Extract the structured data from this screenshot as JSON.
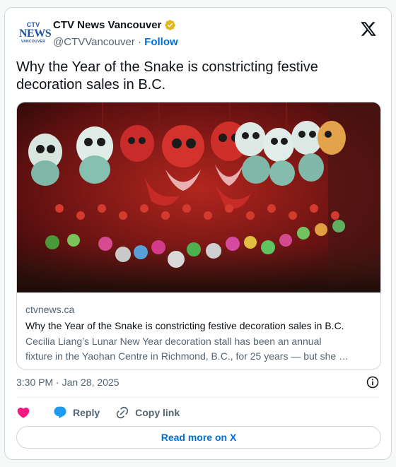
{
  "author": {
    "logo_lines": [
      "CTV",
      "NEWS",
      "VANCOUVER"
    ],
    "name": "CTV News Vancouver",
    "handle": "@CTVVancouver",
    "separator": "·",
    "follow_label": "Follow"
  },
  "tweet": {
    "text": "Why the Year of the Snake is constricting festive decoration sales in B.C."
  },
  "link_card": {
    "domain": "ctvnews.ca",
    "title": "Why the Year of the Snake is constricting festive decoration sales in B.C.",
    "description_line1": "Cecilia Liang’s Lunar New Year decoration stall has been an annual",
    "description_line2": "fixture in the Yaohan Centre in Richmond, B.C., for 25 years — but she …"
  },
  "meta": {
    "timestamp": "3:30 PM · Jan 28, 2025"
  },
  "actions": {
    "reply_label": "Reply",
    "copy_link_label": "Copy link"
  },
  "read_more_label": "Read more on X",
  "colors": {
    "accent": "#006fd6",
    "muted": "#536471",
    "like": "#f91880",
    "reply": "#1d9bf0",
    "verified": "#e2b719"
  },
  "icons": [
    "verified-badge-icon",
    "x-logo-icon",
    "info-icon",
    "heart-icon",
    "reply-bubble-icon",
    "link-icon"
  ]
}
